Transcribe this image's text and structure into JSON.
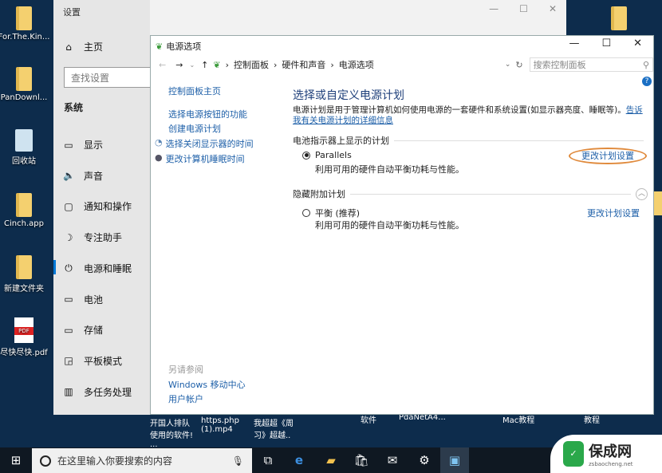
{
  "desktop": {
    "left_icons": [
      "For.The.Kin...",
      "PanDownl...",
      "回收站",
      "Cinch.app",
      "新建文件夹",
      "尽快尽快.pdf"
    ],
    "bottom_labels": [
      "开国人排队使用的软件! ...",
      "https.php (1).mp4",
      "我超超《周习》超越..",
      "软件",
      "PdaNetA4...",
      "Mac教程",
      "教程"
    ]
  },
  "settings": {
    "title": "设置",
    "home": "主页",
    "search_placeholder": "查找设置",
    "section": "系统",
    "items": [
      {
        "icon": "monitor-icon",
        "label": "显示"
      },
      {
        "icon": "speaker-icon",
        "label": "声音"
      },
      {
        "icon": "notification-icon",
        "label": "通知和操作"
      },
      {
        "icon": "moon-icon",
        "label": "专注助手"
      },
      {
        "icon": "power-icon",
        "label": "电源和睡眠"
      },
      {
        "icon": "battery-icon",
        "label": "电池"
      },
      {
        "icon": "storage-icon",
        "label": "存储"
      },
      {
        "icon": "tablet-icon",
        "label": "平板模式"
      },
      {
        "icon": "multitask-icon",
        "label": "多任务处理"
      }
    ],
    "active": "电源和睡眠"
  },
  "cp": {
    "title": "电源选项",
    "breadcrumb": [
      "控制面板",
      "硬件和声音",
      "电源选项"
    ],
    "search_placeholder": "搜索控制面板",
    "sidebar": {
      "home": "控制面板主页",
      "links": [
        "选择电源按钮的功能",
        "创建电源计划",
        "选择关闭显示器的时间",
        "更改计算机睡眠时间"
      ],
      "see_also": "另请参阅",
      "see_also_links": [
        "Windows 移动中心",
        "用户帐户"
      ]
    },
    "heading": "选择或自定义电源计划",
    "desc": "电源计划是用于管理计算机如何使用电源的一套硬件和系统设置(如显示器亮度、睡眠等)。",
    "desc_link": "告诉我有关电源计划的详细信息",
    "group1": "电池指示器上显示的计划",
    "plans1": [
      {
        "name": "Parallels",
        "desc": "利用可用的硬件自动平衡功耗与性能。",
        "selected": true,
        "link": "更改计划设置"
      }
    ],
    "group2": "隐藏附加计划",
    "plans2": [
      {
        "name": "平衡 (推荐)",
        "desc": "利用可用的硬件自动平衡功耗与性能。",
        "selected": false,
        "link": "更改计划设置"
      }
    ],
    "highlight_color": "#e08a3c"
  },
  "taskbar": {
    "search_placeholder": "在这里输入你要搜索的内容"
  },
  "watermark": {
    "name": "保成网",
    "url": "zsbaocheng.net"
  }
}
